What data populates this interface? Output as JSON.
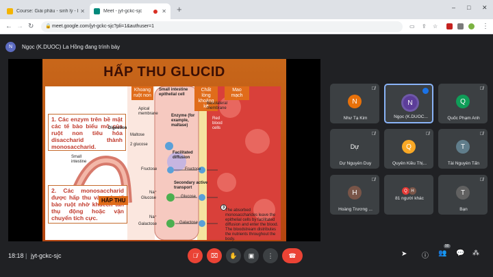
{
  "browser": {
    "tabs": [
      {
        "title": "Course: Giải phẫu - sinh lý - LTIA",
        "active": false
      },
      {
        "title": "Meet - jyt-gckc-sjc",
        "active": true
      }
    ],
    "new_tab": "+",
    "url": "meet.google.com/jyt-gckc-sjc?pli=1&authuser=1",
    "window_controls": [
      "–",
      "□",
      "✕"
    ]
  },
  "meet": {
    "presenter_initial": "N",
    "presenter_text": "Ngọc (K.DUOC) La Hồng đang trình bày",
    "slide": {
      "title": "HẤP THU GLUCID",
      "box1": "1. Các enzym trên bề mặt các tế bào biểu mô của ruột non tiêu hóa disaccharid thành monosaccharid.",
      "box2": "2. Các monosaccharid được hấp thu vào các tế bào ruột nhờ khuếch tán thụ động hoặc vận chuyển tích cực.",
      "chip_khoang": "Khoang ruột non",
      "chip_chatlong": "Chất lỏng khoảng kẽ",
      "chip_maomach": "Mao mạch",
      "hap_thu": "HẤP THU",
      "labels": {
        "epithelial": "Small intestine epithelial cell",
        "apical": "Apical membrane",
        "basolateral": "Basolateral membrane",
        "enzyme": "Enzyme (for example, maltase)",
        "digestion": "Digestion",
        "maltose": "Maltose",
        "two_glucose": "2 glucose",
        "red_blood": "Red blood cells",
        "small_intestine": "Small intestine",
        "facilitated": "Facilitated diffusion",
        "fructose_l": "Fructose",
        "fructose_r": "Fructose",
        "secondary": "Secondary active transport",
        "na1": "Na⁺",
        "glucose_l": "Glucose",
        "glucose_r": "Glucose",
        "na2": "Na⁺",
        "galactose_l": "Galactose",
        "galactose_r": "Galactose",
        "note_num": "3",
        "note": "The absorbed monosaccharides leave the epithelial cells by facilitated diffusion and enter the blood. The bloodstream distributes the nutrients throughout the body."
      }
    },
    "participants": [
      {
        "initial": "N",
        "name": "Như Tạ Kim",
        "color": "#e8710a"
      },
      {
        "initial": "N",
        "name": "Ngọc (K.DUOC...",
        "color": "#5c3d99"
      },
      {
        "initial": "Q",
        "name": "Quốc Phạm Anh",
        "color": "#0f9d58"
      },
      {
        "initial": "Dự",
        "name": "Dự Nguyễn Duy",
        "color": "#3c4043"
      },
      {
        "initial": "Q",
        "name": "Quyên Kiều Thị...",
        "color": "#f9a825"
      },
      {
        "initial": "T",
        "name": "Tài Nguyễn Tấn",
        "color": "#607d8b"
      },
      {
        "initial": "H",
        "name": "Hoàng Trương ...",
        "color": "#795548"
      },
      {
        "initial": "",
        "name": "81 người khác",
        "color": ""
      },
      {
        "initial": "T",
        "name": "Bạn",
        "color": "#616161"
      }
    ],
    "others_initials": [
      "Q",
      "H"
    ]
  },
  "bottom": {
    "time": "18:18",
    "separator": "|",
    "code": "jyt-gckc-sjc",
    "people_count": "90"
  }
}
